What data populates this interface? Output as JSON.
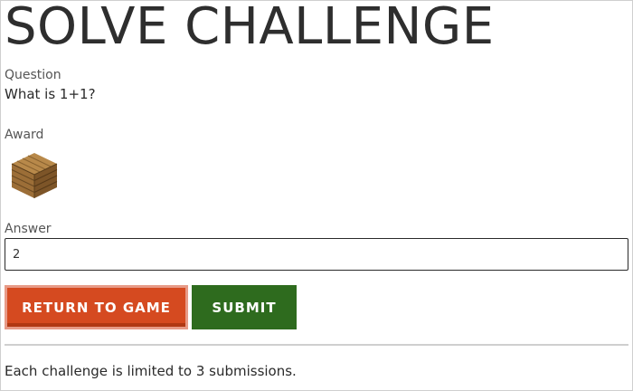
{
  "page": {
    "title": "SOLVE CHALLENGE"
  },
  "question": {
    "label": "Question",
    "text": "What is 1+1?"
  },
  "award": {
    "label": "Award",
    "item": "wood-planks-block-icon"
  },
  "answer": {
    "label": "Answer",
    "value": "2"
  },
  "buttons": {
    "return_label": "RETURN TO GAME",
    "submit_label": "SUBMIT"
  },
  "footer": {
    "note": "Each challenge is limited to 3 submissions."
  },
  "colors": {
    "return_button": "#d54a20",
    "submit_button": "#2e6b1e"
  }
}
